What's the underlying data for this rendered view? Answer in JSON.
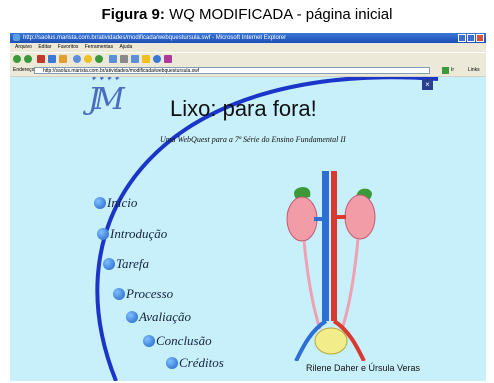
{
  "caption": {
    "prefix": "Figura 9:",
    "text": "WQ MODIFICADA - página inicial"
  },
  "browser": {
    "window_title": "http://saolus.marista.com.br/atividades/modificada/webquestursula.swf - Microsoft Internet Explorer",
    "menu": [
      "Arquivo",
      "Editar",
      "Favoritos",
      "Ferramentas",
      "Ajuda"
    ],
    "address_label": "Endereço",
    "address_value": "http://saolus.marista.com.br/atividades/modificada/webquestursula.swf",
    "go_label": "Ir",
    "links_label": "Links"
  },
  "page": {
    "logo_text": "JM",
    "title": "Lixo: para fora!",
    "subtitle": "Uma WebQuest para a 7ª Série do Ensino Fundamental II",
    "close_label": "×",
    "nav": [
      {
        "label": "Início"
      },
      {
        "label": "Introdução"
      },
      {
        "label": "Tarefa"
      },
      {
        "label": "Processo"
      },
      {
        "label": "Avaliação"
      },
      {
        "label": "Conclusão"
      },
      {
        "label": "Créditos"
      }
    ],
    "authors": "Rilene Daher e Úrsula Veras"
  },
  "colors": {
    "content_bg": "#c8f0fb",
    "arc": "#1a35c8",
    "kidney": "#f29ca8",
    "artery": "#d93a2f",
    "vein": "#2e6fd6",
    "adrenal": "#3a9a3a",
    "bladder": "#f2ec8a"
  }
}
